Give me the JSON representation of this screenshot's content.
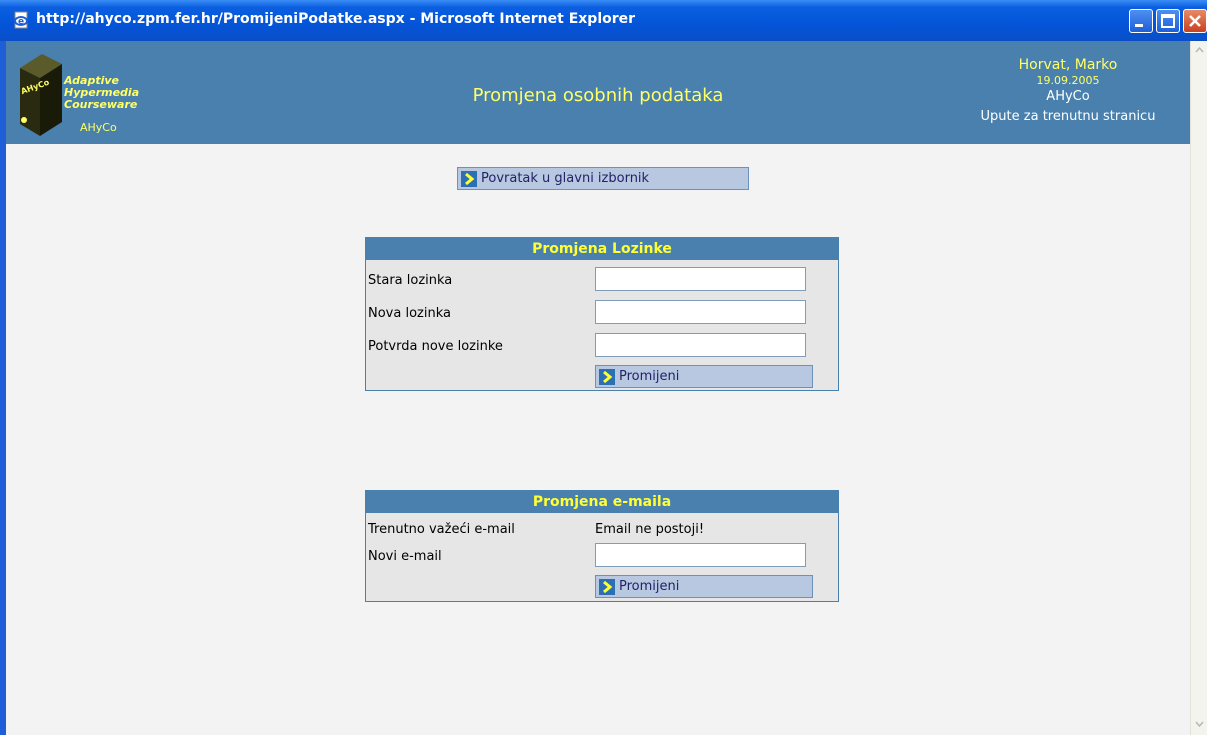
{
  "window": {
    "title": "http://ahyco.zpm.fer.hr/PromijeniPodatke.aspx - Microsoft Internet Explorer"
  },
  "header": {
    "logo_text": "Adaptive Hypermedia Courseware",
    "logo_line1": "Adaptive",
    "logo_line2": "Hypermedia",
    "logo_line3": "Courseware",
    "logo_sub": "AHyCo",
    "logo_book_label": "AHyCo",
    "page_title": "Promjena osobnih podataka",
    "user_name": "Horvat, Marko",
    "date": "19.09.2005",
    "app_name": "AHyCo",
    "help_link": "Upute za trenutnu stranicu"
  },
  "nav": {
    "back_label": "Povratak u glavni izbornik"
  },
  "password_panel": {
    "title": "Promjena Lozinke",
    "old_label": "Stara lozinka",
    "old_value": "",
    "new_label": "Nova lozinka",
    "new_value": "",
    "confirm_label": "Potvrda nove lozinke",
    "confirm_value": "",
    "submit_label": "Promijeni"
  },
  "email_panel": {
    "title": "Promjena e-maila",
    "current_label": "Trenutno važeći e-mail",
    "current_value": "Email ne postoji!",
    "new_label": "Novi e-mail",
    "new_value": "",
    "submit_label": "Promijeni"
  },
  "colors": {
    "header_bg": "#4a80ad",
    "accent_yellow": "#ffff66",
    "panel_bg": "#e6e6e6",
    "page_bg": "#f3f3f3"
  },
  "icons": [
    "ie-page-icon",
    "minimize-icon",
    "maximize-icon",
    "close-icon",
    "chevron-right-icon",
    "scroll-up-icon",
    "scroll-down-icon",
    "book-logo-icon"
  ]
}
